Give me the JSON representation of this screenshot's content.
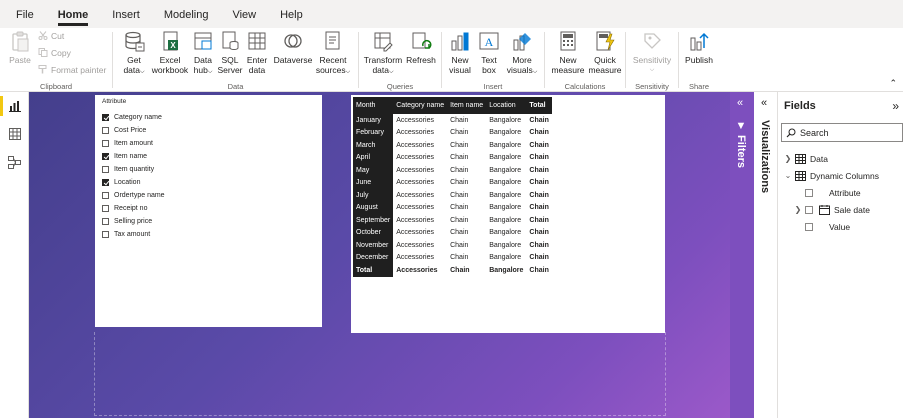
{
  "menu": {
    "tabs": [
      {
        "label": "File"
      },
      {
        "label": "Home",
        "active": true
      },
      {
        "label": "Insert"
      },
      {
        "label": "Modeling"
      },
      {
        "label": "View"
      },
      {
        "label": "Help"
      }
    ]
  },
  "ribbon": {
    "clipboard": {
      "label": "Clipboard",
      "paste": "Paste",
      "cut": "Cut",
      "copy": "Copy",
      "format_painter": "Format painter"
    },
    "data": {
      "label": "Data",
      "get_data_1": "Get",
      "get_data_2": "data",
      "excel_1": "Excel",
      "excel_2": "workbook",
      "data_hub_1": "Data",
      "data_hub_2": "hub",
      "sql_1": "SQL",
      "sql_2": "Server",
      "enter_1": "Enter",
      "enter_2": "data",
      "dataverse": "Dataverse",
      "recent_1": "Recent",
      "recent_2": "sources"
    },
    "queries": {
      "label": "Queries",
      "transform_1": "Transform",
      "transform_2": "data",
      "refresh": "Refresh"
    },
    "insert": {
      "label": "Insert",
      "new_visual_1": "New",
      "new_visual_2": "visual",
      "text_box_1": "Text",
      "text_box_2": "box",
      "more_visuals_1": "More",
      "more_visuals_2": "visuals"
    },
    "calculations": {
      "label": "Calculations",
      "new_measure_1": "New",
      "new_measure_2": "measure",
      "quick_measure_1": "Quick",
      "quick_measure_2": "measure"
    },
    "sensitivity": {
      "label": "Sensitivity",
      "btn": "Sensitivity"
    },
    "share": {
      "label": "Share",
      "publish": "Publish"
    }
  },
  "slicer": {
    "title": "Attribute",
    "items": [
      {
        "label": "Category name",
        "checked": true
      },
      {
        "label": "Cost Price",
        "checked": false
      },
      {
        "label": "Item amount",
        "checked": false
      },
      {
        "label": "Item name",
        "checked": true
      },
      {
        "label": "Item quantity",
        "checked": false
      },
      {
        "label": "Location",
        "checked": true
      },
      {
        "label": "Ordertype name",
        "checked": false
      },
      {
        "label": "Receipt no",
        "checked": false
      },
      {
        "label": "Selling price",
        "checked": false
      },
      {
        "label": "Tax amount",
        "checked": false
      }
    ]
  },
  "table": {
    "headers": [
      "Month",
      "Category name",
      "Item name",
      "Location",
      "Total"
    ],
    "rows": [
      [
        "January",
        "Accessories",
        "Chain",
        "Bangalore",
        "Chain"
      ],
      [
        "February",
        "Accessories",
        "Chain",
        "Bangalore",
        "Chain"
      ],
      [
        "March",
        "Accessories",
        "Chain",
        "Bangalore",
        "Chain"
      ],
      [
        "April",
        "Accessories",
        "Chain",
        "Bangalore",
        "Chain"
      ],
      [
        "May",
        "Accessories",
        "Chain",
        "Bangalore",
        "Chain"
      ],
      [
        "June",
        "Accessories",
        "Chain",
        "Bangalore",
        "Chain"
      ],
      [
        "July",
        "Accessories",
        "Chain",
        "Bangalore",
        "Chain"
      ],
      [
        "August",
        "Accessories",
        "Chain",
        "Bangalore",
        "Chain"
      ],
      [
        "September",
        "Accessories",
        "Chain",
        "Bangalore",
        "Chain"
      ],
      [
        "October",
        "Accessories",
        "Chain",
        "Bangalore",
        "Chain"
      ],
      [
        "November",
        "Accessories",
        "Chain",
        "Bangalore",
        "Chain"
      ],
      [
        "December",
        "Accessories",
        "Chain",
        "Bangalore",
        "Chain"
      ]
    ],
    "total_row": [
      "Total",
      "Accessories",
      "Chain",
      "Bangalore",
      "Chain"
    ]
  },
  "panes": {
    "filters": "Filters",
    "visualizations": "Visualizations"
  },
  "fields": {
    "title": "Fields",
    "search_placeholder": "Search",
    "tables": [
      {
        "label": "Data",
        "expanded": false
      },
      {
        "label": "Dynamic Columns",
        "expanded": true
      }
    ],
    "dynamic_columns": [
      "Attribute",
      "Sale date",
      "Value"
    ]
  },
  "colors": {
    "accent_yellow": "#f2c811",
    "canvas_start": "#443f8c",
    "canvas_end": "#9b59c9"
  }
}
